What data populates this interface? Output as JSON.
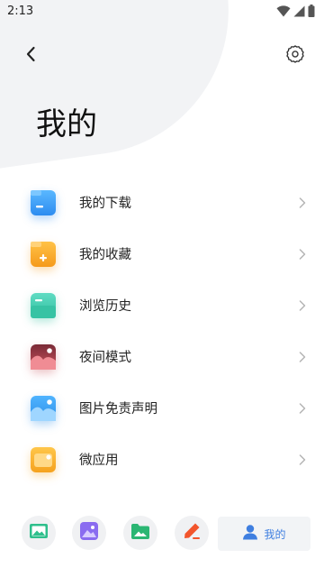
{
  "status_bar": {
    "time": "2:13"
  },
  "header": {
    "title": "我的"
  },
  "menu": {
    "items": [
      {
        "label": "我的下载",
        "icon": "folder-download-icon",
        "color": "#3b9cf7"
      },
      {
        "label": "我的收藏",
        "icon": "folder-favorite-icon",
        "color": "#f7a82b"
      },
      {
        "label": "浏览历史",
        "icon": "history-icon",
        "color": "#3cc9b0"
      },
      {
        "label": "夜间模式",
        "icon": "night-mode-icon",
        "color": "#b83d4a"
      },
      {
        "label": "图片免责声明",
        "icon": "image-disclaimer-icon",
        "color": "#3aa4f2"
      },
      {
        "label": "微应用",
        "icon": "micro-app-icon",
        "color": "#f7b52c"
      }
    ]
  },
  "bottom_nav": {
    "items": [
      {
        "icon": "landscape-image-icon",
        "color": "#2fbf8c"
      },
      {
        "icon": "photo-gallery-icon",
        "color": "#8a6cf0"
      },
      {
        "icon": "folder-image-icon",
        "color": "#2bb673"
      },
      {
        "icon": "pencil-icon",
        "color": "#f2552c"
      }
    ],
    "active": {
      "label": "我的",
      "icon": "user-icon",
      "color": "#3f7fe0"
    }
  }
}
